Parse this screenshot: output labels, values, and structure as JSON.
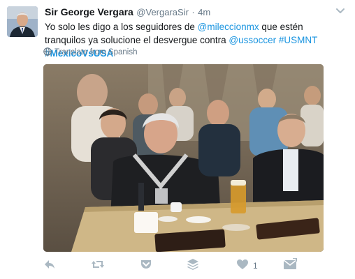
{
  "tweet": {
    "author_name": "Sir George Vergara",
    "handle": "@VergaraSir",
    "separator": "·",
    "time": "4m",
    "text_prefix": "Yo solo les digo a los seguidores de ",
    "mention1": "@mileccionmx",
    "text_mid1": " que estén tranquilos ya solucione el desvergue contra ",
    "mention2": "@ussoccer",
    "space1": " ",
    "hashtag1": "#USMNT",
    "space2": " ",
    "hashtag2": "#MexicoVsUSA",
    "translate_label": "Translate from Spanish",
    "like_count": "1"
  },
  "icons": {
    "globe": "globe-icon",
    "reply": "reply-icon",
    "retweet": "retweet-icon",
    "pocket": "pocket-icon",
    "buffer": "buffer-icon",
    "like": "heart-icon",
    "dm": "direct-message-icon",
    "caret": "chevron-down-icon"
  },
  "colors": {
    "link": "#1b95e0",
    "muted": "#657786",
    "text": "#14171a",
    "icon": "#aab8c2"
  }
}
